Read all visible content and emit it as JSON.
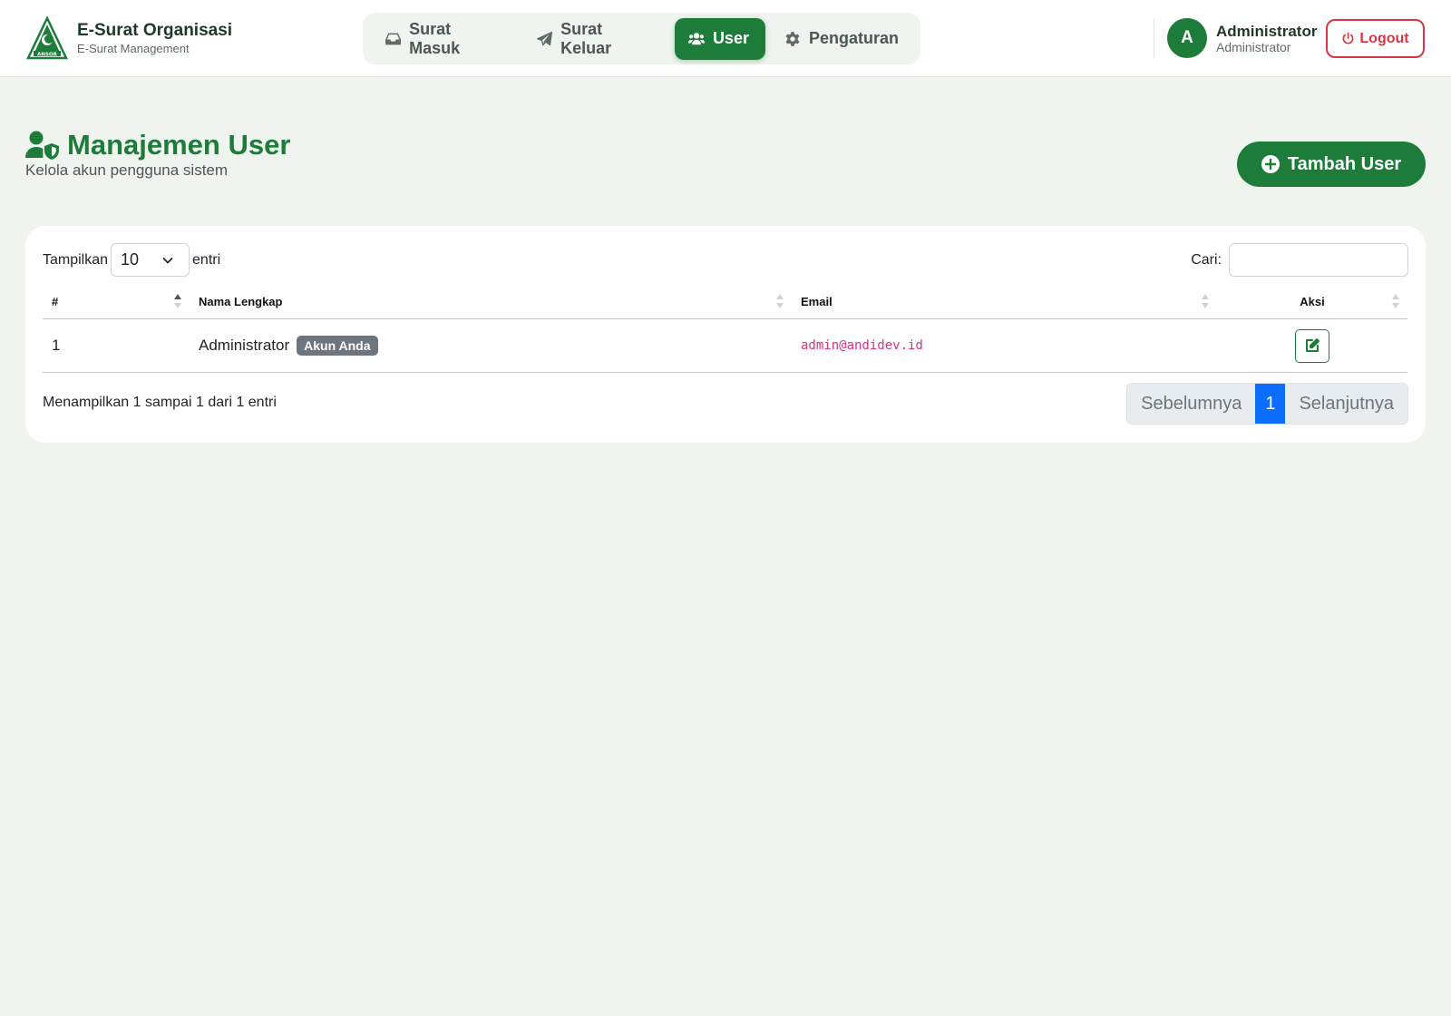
{
  "brand": {
    "title": "E-Surat Organisasi",
    "subtitle": "E-Surat Management",
    "logo_text": "ANSOR"
  },
  "nav": {
    "items": [
      {
        "label": "Surat Masuk",
        "icon": "inbox-icon"
      },
      {
        "label": "Surat Keluar",
        "icon": "paper-plane-icon"
      },
      {
        "label": "User",
        "icon": "users-icon",
        "active": true
      },
      {
        "label": "Pengaturan",
        "icon": "gear-icon"
      }
    ]
  },
  "user": {
    "initial": "A",
    "name": "Administrator",
    "role": "Administrator",
    "logout_label": "Logout"
  },
  "page": {
    "title": "Manajemen User",
    "subtitle": "Kelola akun pengguna sistem",
    "add_label": "Tambah User"
  },
  "table_controls": {
    "show_prefix": "Tampilkan",
    "page_length": "10",
    "show_suffix": "entri",
    "search_label": "Cari:",
    "search_value": ""
  },
  "table": {
    "columns": [
      "#",
      "Nama Lengkap",
      "Email",
      "Aksi"
    ],
    "rows": [
      {
        "no": "1",
        "name": "Administrator",
        "badge": "Akun Anda",
        "email": "admin@andidev.id"
      }
    ]
  },
  "footer": {
    "info": "Menampilkan 1 sampai 1 dari 1 entri",
    "prev_label": "Sebelumnya",
    "current_page": "1",
    "next_label": "Selanjutnya"
  },
  "colors": {
    "primary": "#1e7c3a",
    "background": "#eff4ee",
    "danger": "#dc3545",
    "page_active": "#0d6efd",
    "email": "#d63384",
    "badge": "#6c757d"
  }
}
